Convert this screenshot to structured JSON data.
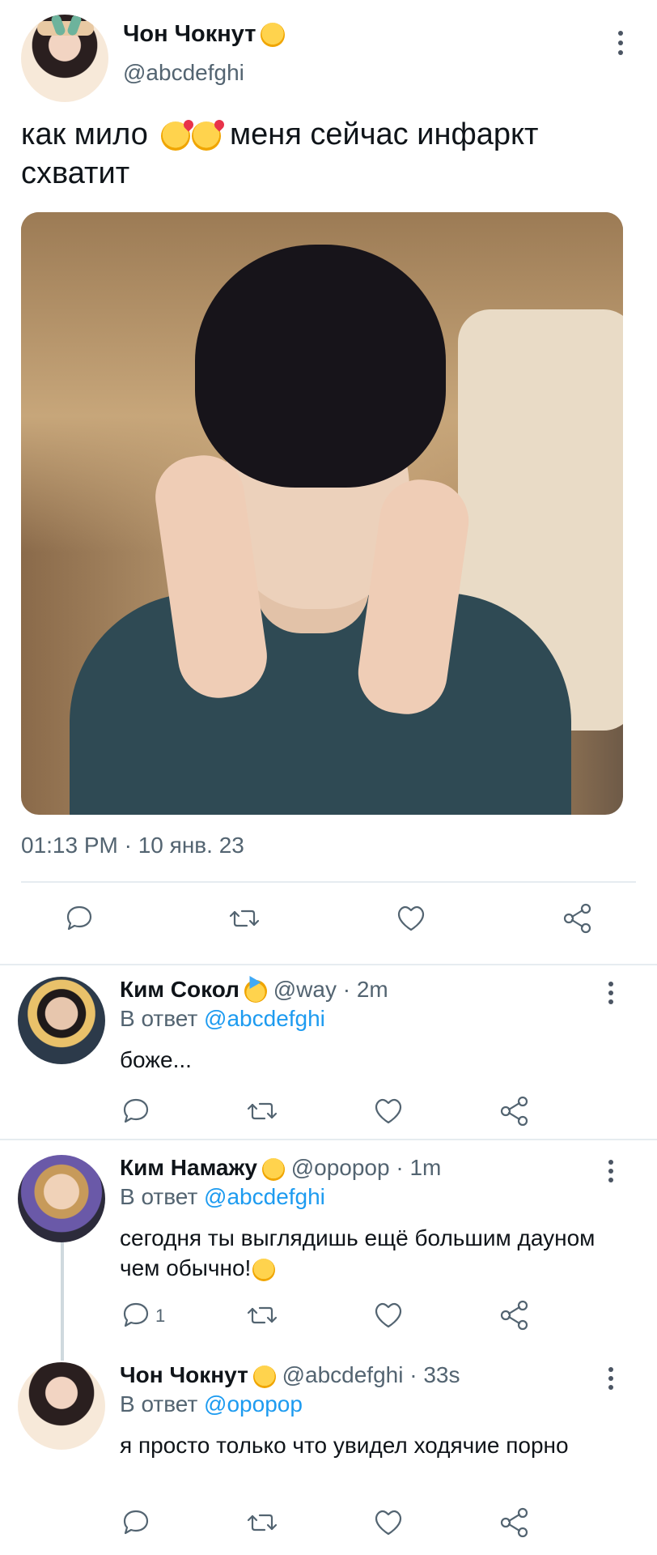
{
  "main_tweet": {
    "author_name": "Чон Чокнут",
    "author_handle": "@abcdefghi",
    "text_part1": "как мило",
    "text_part2": "меня сейчас инфаркт схватит",
    "timestamp": "01:13 PM · 10 янв. 23"
  },
  "replies": [
    {
      "author_name": "Ким Сокол",
      "handle_time": "@way · 2m",
      "replying_prefix": "В ответ",
      "replying_to": "@abcdefghi",
      "text": "боже...",
      "reply_count": ""
    },
    {
      "author_name": "Ким Намажу",
      "handle_time": "@opopop · 1m",
      "replying_prefix": "В ответ",
      "replying_to": "@abcdefghi",
      "text": "сегодня ты выглядишь  ещё большим дауном чем обычно!",
      "reply_count": "1"
    },
    {
      "author_name": "Чон Чокнут",
      "handle_time": "@abcdefghi · 33s",
      "replying_prefix": "В ответ",
      "replying_to": "@opopop",
      "text": "я просто только что увидел ходячие порно",
      "reply_count": ""
    }
  ],
  "icons": {
    "reply": "reply-icon",
    "retweet": "retweet-icon",
    "like": "heart-icon",
    "share": "share-icon",
    "more": "more-vertical-icon"
  },
  "colors": {
    "link": "#1d9bf0",
    "muted": "#536471",
    "text": "#0f1419"
  }
}
